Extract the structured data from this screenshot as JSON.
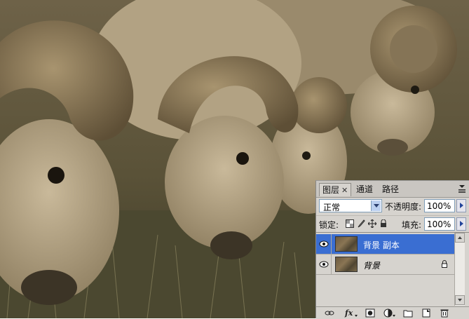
{
  "photo": {
    "subject": "bighorn-rams-grazing",
    "palette": [
      "#8b7b5e",
      "#5c5138",
      "#3f3a28",
      "#b8a888"
    ]
  },
  "panel": {
    "tabs": [
      {
        "label": "图层",
        "active": true,
        "closable": true
      },
      {
        "label": "通道",
        "active": false
      },
      {
        "label": "路径",
        "active": false
      }
    ],
    "blend_mode": "正常",
    "opacity_label": "不透明度:",
    "opacity_value": "100%",
    "lock_label": "锁定:",
    "fill_label": "填充:",
    "fill_value": "100%",
    "layers": [
      {
        "name": "背景 副本",
        "selected": true,
        "visible": true,
        "locked": false
      },
      {
        "name": "背景",
        "selected": false,
        "visible": true,
        "locked": true,
        "italic": true
      }
    ],
    "bottom_icons": [
      "link-layers-icon",
      "layer-style-fx-icon",
      "add-mask-icon",
      "adjustment-layer-icon",
      "new-group-icon",
      "new-layer-icon",
      "delete-layer-icon"
    ],
    "colors": {
      "selected": "#3a6ed2",
      "panel_bg": "#d6d3ce"
    }
  }
}
